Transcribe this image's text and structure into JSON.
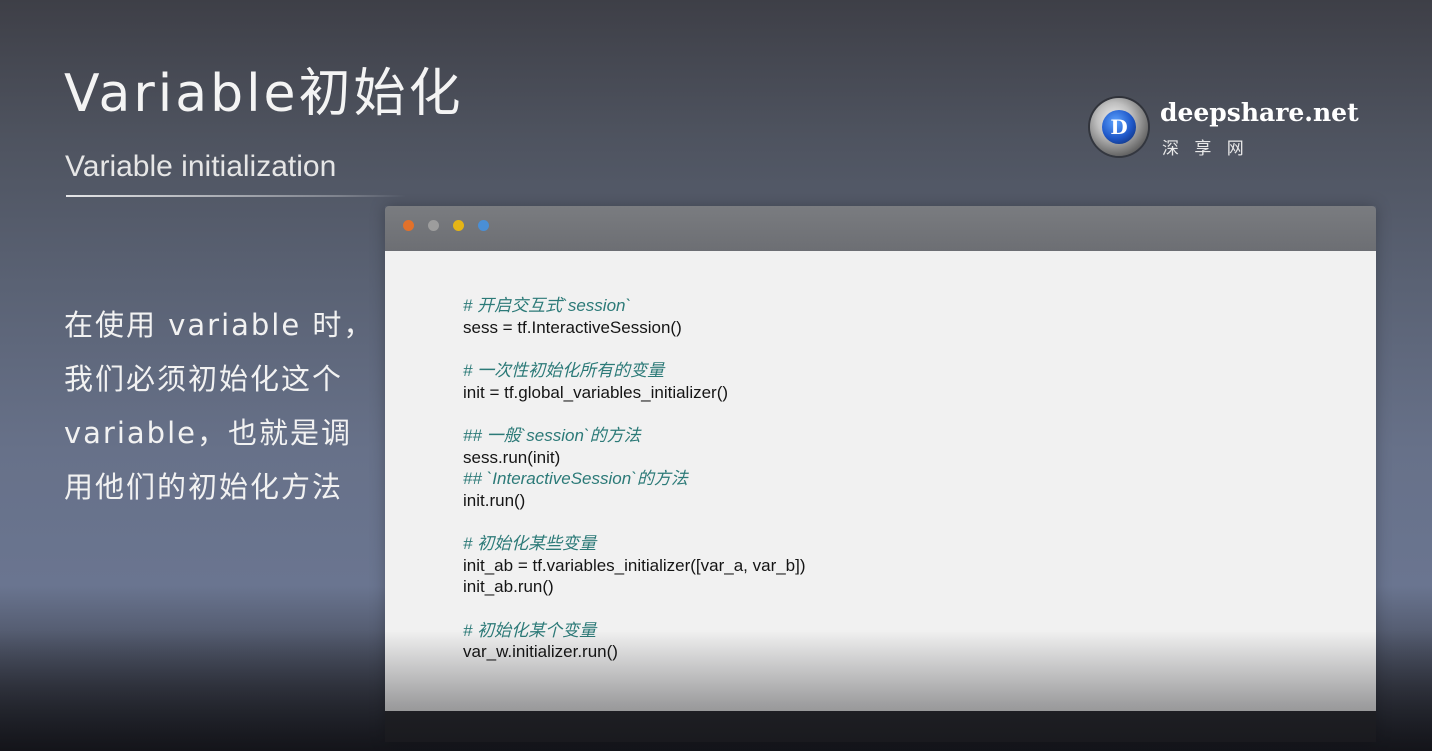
{
  "slide": {
    "title": "Variable初始化",
    "subtitle": "Variable initialization",
    "description_lines": [
      "在使用 variable 时，",
      "我们必须初始化这个",
      "variable，也就是调",
      "用他们的初始化方法"
    ]
  },
  "logo": {
    "name": "deepshare.net",
    "cn_name": "深 享 网",
    "mark": "D"
  },
  "code_window": {
    "traffic_light_colors": [
      "#e2712a",
      "#9d9d9d",
      "#e5b516",
      "#4a8fd6"
    ],
    "lines": [
      {
        "text": "# 开启交互式`session`",
        "comment": true
      },
      {
        "text": "sess = tf.InteractiveSession()",
        "comment": false
      },
      {
        "text": "# 一次性初始化所有的变量",
        "comment": true
      },
      {
        "text": "init = tf.global_variables_initializer()",
        "comment": false
      },
      {
        "text": "## 一般`session`的方法",
        "comment": true
      },
      {
        "text": "sess.run(init)",
        "comment": false
      },
      {
        "text": "## `InteractiveSession`的方法",
        "comment": true
      },
      {
        "text": "init.run()",
        "comment": false
      },
      {
        "text": "# 初始化某些变量",
        "comment": true
      },
      {
        "text": "init_ab = tf.variables_initializer([var_a, var_b])",
        "comment": false
      },
      {
        "text": "init_ab.run()",
        "comment": false
      },
      {
        "text": "# 初始化某个变量",
        "comment": true
      },
      {
        "text": "var_w.initializer.run()",
        "comment": false
      }
    ]
  }
}
